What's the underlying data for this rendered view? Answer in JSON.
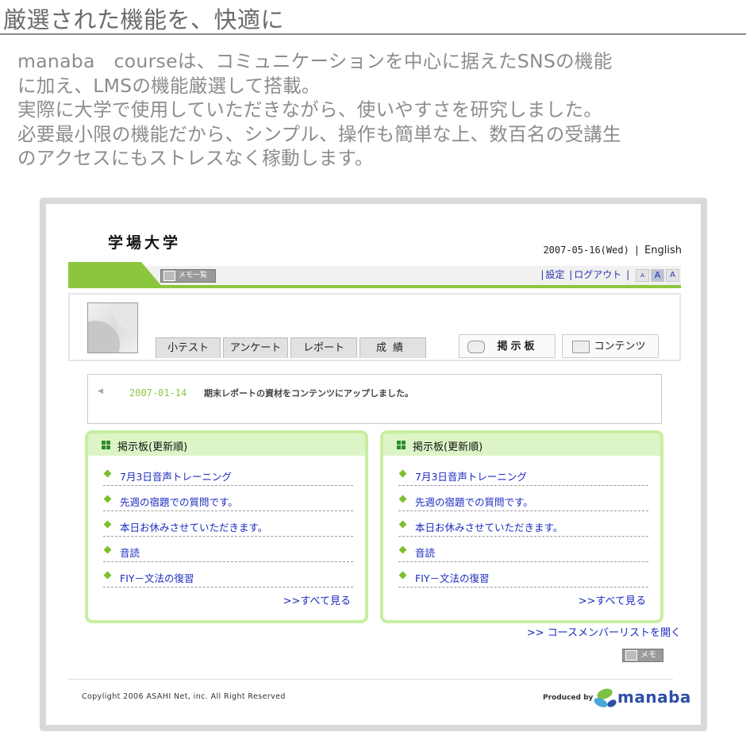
{
  "heading": "厳選された機能を、快適に",
  "intro": [
    "manaba　courseは、コミュニケーションを中心に据えたSNSの機能",
    "に加え、LMSの機能厳選して搭載。",
    "実際に大学で使用していただきながら、使いやすさを研究しました。",
    "必要最小限の機能だから、シンプル、操作も簡単な上、数百名の受講生",
    "のアクセスにもストレスなく稼動します。"
  ],
  "app": {
    "university": "学場大学",
    "date": "2007-05-16(Wed)",
    "separator": "|",
    "language_link": "English",
    "memo_list_button": "メモ一覧",
    "nav_links": {
      "settings": "設定",
      "logout": "ログアウト",
      "pipe": "|"
    },
    "font_sizes": [
      "A",
      "A",
      "A"
    ],
    "course_tabs": [
      "小テスト",
      "アンケート",
      "レポート",
      "成績"
    ],
    "board_tab": "掲示板",
    "contents_tab": "コンテンツ",
    "notice": {
      "arrow": "◀",
      "date": "2007-01-14",
      "text": "期末レポートの資材をコンテンツにアップしました。"
    },
    "boards": [
      {
        "title": "掲示板(更新順)",
        "items": [
          "7月3日音声トレーニング",
          "先週の宿題での質問です。",
          "本日お休みさせていただきます。",
          "音読",
          "FIY－文法の復習"
        ],
        "more": ">>すべて見る"
      },
      {
        "title": "掲示板(更新順)",
        "items": [
          "7月3日音声トレーニング",
          "先週の宿題での質問です。",
          "本日お休みさせていただきます。",
          "音読",
          "FIY－文法の復習"
        ],
        "more": ">>すべて見る"
      }
    ],
    "member_list_link": ">> コースメンバーリストを開く",
    "memo_button": "メモ",
    "copyright": "Copylight  2006  ASAHI  Net,  inc.   All  Right    Reserved",
    "produced_by": "Produced  by",
    "logo_text": "manaba"
  },
  "colors": {
    "accent_green": "#8cc63f",
    "link_blue": "#1a2bbf",
    "board_border": "#c8eea0"
  }
}
